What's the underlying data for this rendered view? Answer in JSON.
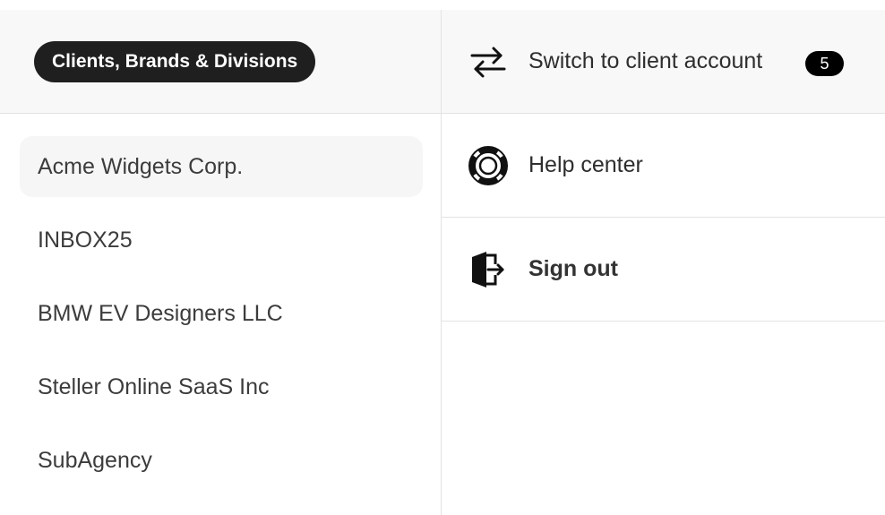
{
  "clients_panel": {
    "header_label": "Clients, Brands & Divisions",
    "items": [
      {
        "label": "Acme Widgets Corp."
      },
      {
        "label": "INBOX25"
      },
      {
        "label": "BMW EV Designers LLC"
      },
      {
        "label": "Steller Online SaaS Inc"
      },
      {
        "label": "SubAgency"
      }
    ]
  },
  "account_menu": {
    "switch": {
      "label": "Switch to client account",
      "badge": "5",
      "icon": "switch-arrows-icon"
    },
    "help": {
      "label": "Help center",
      "icon": "lifebuoy-icon"
    },
    "signout": {
      "label": "Sign out",
      "icon": "exit-door-icon"
    }
  }
}
